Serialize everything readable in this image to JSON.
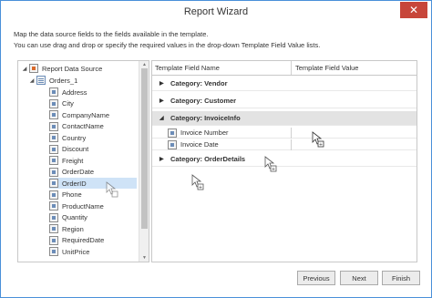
{
  "window": {
    "title": "Report Wizard",
    "close_glyph": "✕"
  },
  "description": {
    "line1": "Map the data source fields to the fields available in the template.",
    "line2": "You can use drag and drop or specify the required values in the drop-down Template Field Value lists."
  },
  "tree": {
    "root": "Report Data Source",
    "table": "Orders_1",
    "fields": [
      "Address",
      "City",
      "CompanyName",
      "ContactName",
      "Country",
      "Discount",
      "Freight",
      "OrderDate",
      "OrderID",
      "Phone",
      "ProductName",
      "Quantity",
      "Region",
      "RequiredDate",
      "UnitPrice"
    ],
    "selected_field": "OrderID"
  },
  "grid": {
    "headers": {
      "field": "Template Field Name",
      "value": "Template Field Value"
    },
    "categories": {
      "vendor": "Category: Vendor",
      "customer": "Category: Customer",
      "invoiceinfo": "Category: InvoiceInfo",
      "orderdetails": "Category: OrderDetails"
    },
    "invoice_fields": [
      "Invoice Number",
      "Invoice Date"
    ]
  },
  "buttons": {
    "previous": "Previous",
    "next": "Next",
    "finish": "Finish"
  },
  "icons": {
    "expand": "expand-arrow-icon",
    "collapse": "collapse-arrow-icon",
    "drag": "drag-cursor-icon"
  },
  "colors": {
    "accent": "#4a90d9",
    "close": "#c7463a",
    "selection": "#cfe3f7"
  }
}
